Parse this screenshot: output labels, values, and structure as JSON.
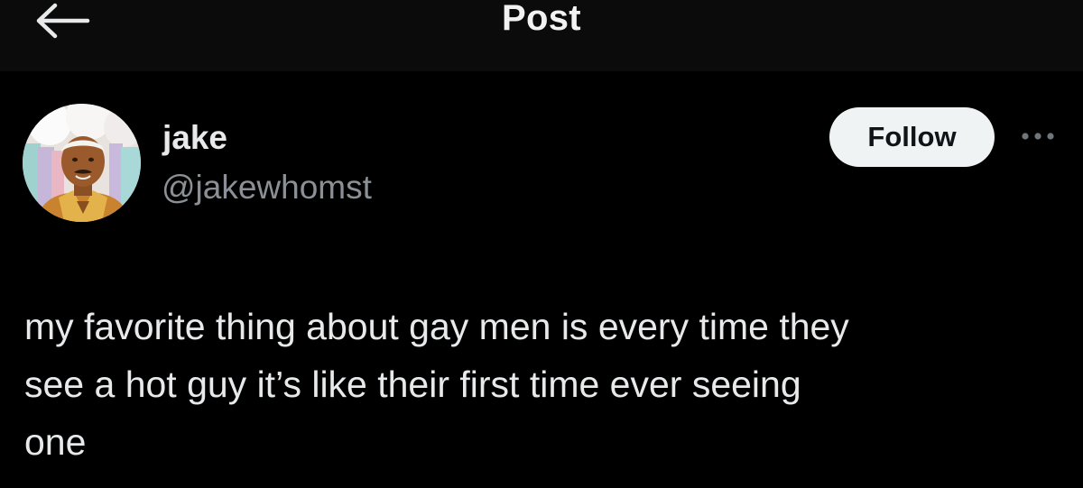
{
  "header": {
    "title": "Post",
    "back_icon": "arrow-left-icon"
  },
  "author": {
    "name": "jake",
    "handle": "@jakewhomst",
    "avatar_icon": "profile-photo"
  },
  "actions": {
    "follow_label": "Follow",
    "more_icon": "more-horizontal-icon"
  },
  "post": {
    "text": "my favorite thing about gay men is every time they\nsee a hot guy it’s like their first time ever seeing\none"
  },
  "colors": {
    "background": "#000000",
    "header_background": "#0b0b0b",
    "text_primary": "#e7e9ea",
    "text_secondary": "#8b9096",
    "follow_button_bg": "#eff3f4",
    "follow_button_text": "#0f1419"
  }
}
